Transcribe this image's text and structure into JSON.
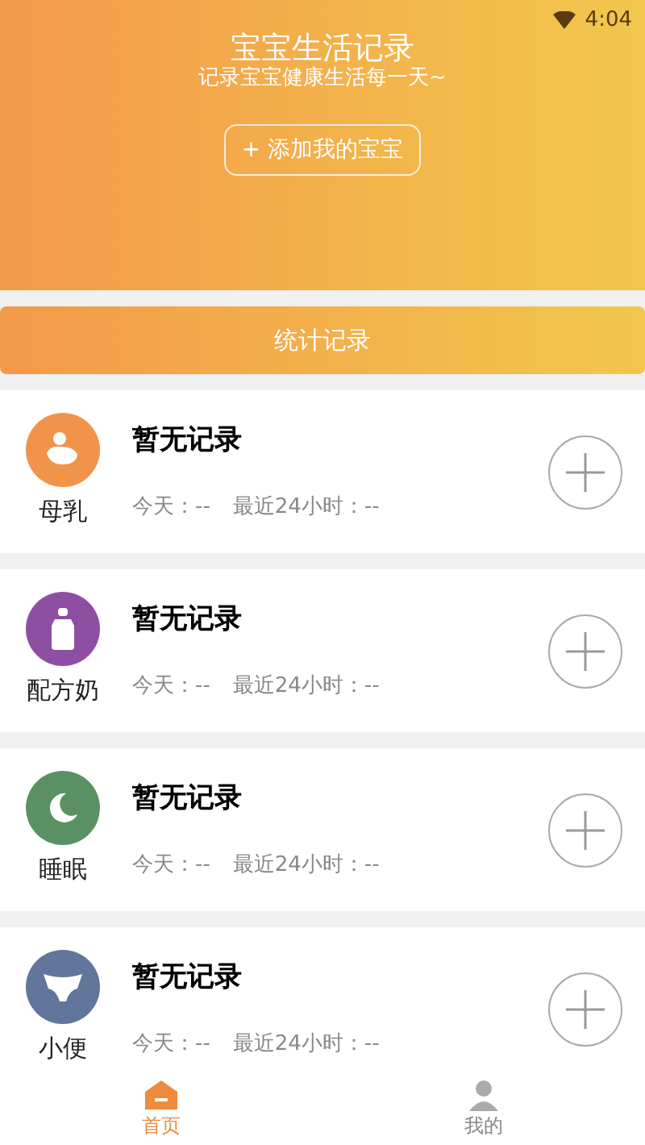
{
  "status_bar": {
    "time": "4:04"
  },
  "header": {
    "title": "宝宝生活记录",
    "subtitle": "记录宝宝健康生活每一天~",
    "add_button": "+ 添加我的宝宝"
  },
  "stats_button": "统计记录",
  "records": [
    {
      "kind": "breastfeed",
      "color": "#f0944a",
      "label": "母乳",
      "title": "暂无记录",
      "today": "今天：--",
      "last24": "最近24小时：--"
    },
    {
      "kind": "formula",
      "color": "#8e4fa3",
      "label": "配方奶",
      "title": "暂无记录",
      "today": "今天：--",
      "last24": "最近24小时：--"
    },
    {
      "kind": "sleep",
      "color": "#5a9164",
      "label": "睡眠",
      "title": "暂无记录",
      "today": "今天：--",
      "last24": "最近24小时：--"
    },
    {
      "kind": "diaper",
      "color": "#62759a",
      "label": "小便",
      "title": "暂无记录",
      "today": "今天：--",
      "last24": "最近24小时：--"
    }
  ],
  "nav": [
    {
      "kind": "home",
      "label": "首页",
      "selected": true
    },
    {
      "kind": "me",
      "label": "我的",
      "selected": false
    }
  ]
}
